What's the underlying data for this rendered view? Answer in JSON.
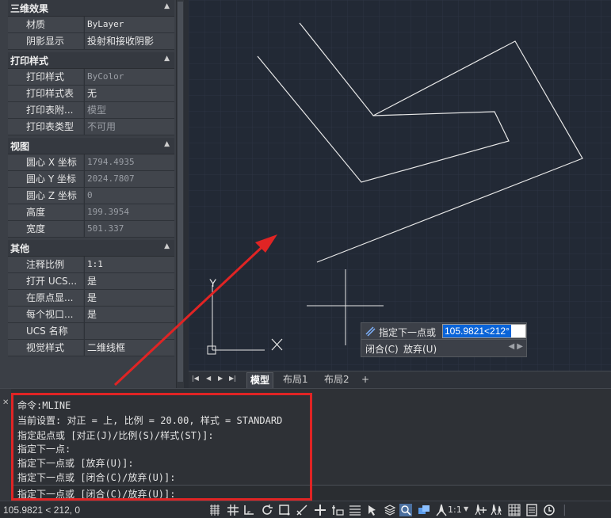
{
  "properties": {
    "sections": [
      {
        "title": "三维效果",
        "rows": [
          {
            "key": "材质",
            "value": "ByLayer"
          },
          {
            "key": "阴影显示",
            "value": "投射和接收阴影"
          }
        ]
      },
      {
        "title": "打印样式",
        "rows": [
          {
            "key": "打印样式",
            "value": "ByColor"
          },
          {
            "key": "打印样式表",
            "value": "无"
          },
          {
            "key": "打印表附...",
            "value": "模型"
          },
          {
            "key": "打印表类型",
            "value": "不可用"
          }
        ]
      },
      {
        "title": "视图",
        "rows": [
          {
            "key": "圆心 X 坐标",
            "value": "1794.4935"
          },
          {
            "key": "圆心 Y 坐标",
            "value": "2024.7807"
          },
          {
            "key": "圆心 Z 坐标",
            "value": "0"
          },
          {
            "key": "高度",
            "value": "199.3954"
          },
          {
            "key": "宽度",
            "value": "501.337"
          }
        ]
      },
      {
        "title": "其他",
        "rows": [
          {
            "key": "注释比例",
            "value": "1:1"
          },
          {
            "key": "打开 UCS...",
            "value": "是"
          },
          {
            "key": "在原点显...",
            "value": "是"
          },
          {
            "key": "每个视口...",
            "value": "是"
          },
          {
            "key": "UCS 名称",
            "value": ""
          },
          {
            "key": "视觉样式",
            "value": "二维线框"
          }
        ]
      }
    ]
  },
  "canvas": {
    "dynamic_input": {
      "prompt": "指定下一点或",
      "value": "105.9821<212°",
      "options": [
        "闭合(C)",
        "放弃(U)"
      ]
    },
    "ucs_label": "Y"
  },
  "layout_tabs": {
    "tabs": [
      "模型",
      "布局1",
      "布局2",
      "+"
    ],
    "active": "模型"
  },
  "command_window": {
    "history": [
      "命令:MLINE",
      "当前设置: 对正 = 上, 比例 = 20.00, 样式 = STANDARD",
      "指定起点或 [对正(J)/比例(S)/样式(ST)]:",
      "指定下一点:",
      "指定下一点或 [放弃(U)]:",
      "指定下一点或 [闭合(C)/放弃(U)]:"
    ],
    "current_prompt": "指定下一点或 [闭合(C)/放弃(U)]:"
  },
  "status_bar": {
    "coordinates": "105.9821 < 212, 0",
    "annotation_scale": "1:1"
  },
  "colors": {
    "canvas_bg": "#222935",
    "annotation_red": "#e02424",
    "selection_blue": "#0a64d8"
  }
}
